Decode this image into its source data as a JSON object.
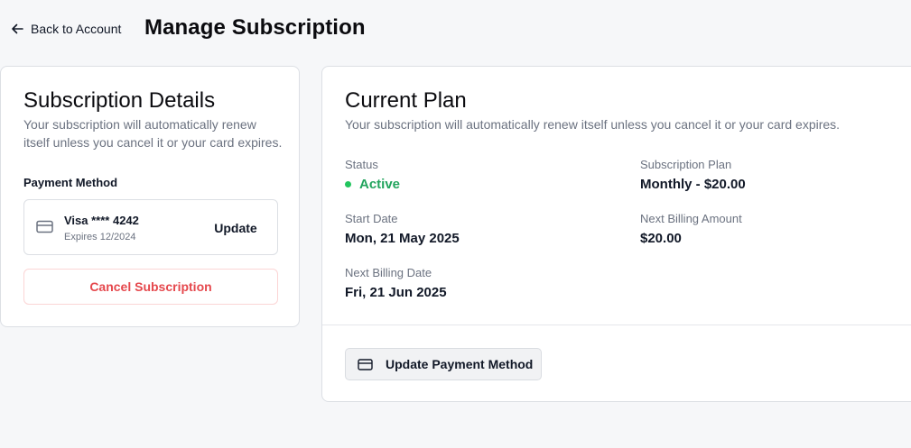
{
  "header": {
    "back_label": "Back to Account",
    "page_title": "Manage Subscription"
  },
  "details_card": {
    "title": "Subscription Details",
    "description": "Your subscription will automatically renew itself unless you cancel it or your card expires.",
    "payment_method_label": "Payment Method",
    "card": {
      "name": "Visa **** 4242",
      "expires": "Expires 12/2024",
      "update_label": "Update",
      "icon": "credit-card-icon"
    },
    "cancel_label": "Cancel Subscription"
  },
  "plan_card": {
    "title": "Current Plan",
    "description": "Your subscription will automatically renew itself unless you cancel it or your card expires.",
    "status_label": "Status",
    "status_value": "Active",
    "subscription_plan_label": "Subscription Plan",
    "subscription_plan_value": "Monthly - $20.00",
    "start_date_label": "Start Date",
    "start_date_value": "Mon, 21 May 2025",
    "next_billing_amount_label": "Next Billing Amount",
    "next_billing_amount_value": "$20.00",
    "next_billing_date_label": "Next Billing Date",
    "next_billing_date_value": "Fri, 21 Jun 2025",
    "update_payment_label": "Update Payment Method"
  },
  "colors": {
    "background": "#f6f7f9",
    "active_green": "#22a45d",
    "danger_red": "#e5484d"
  }
}
